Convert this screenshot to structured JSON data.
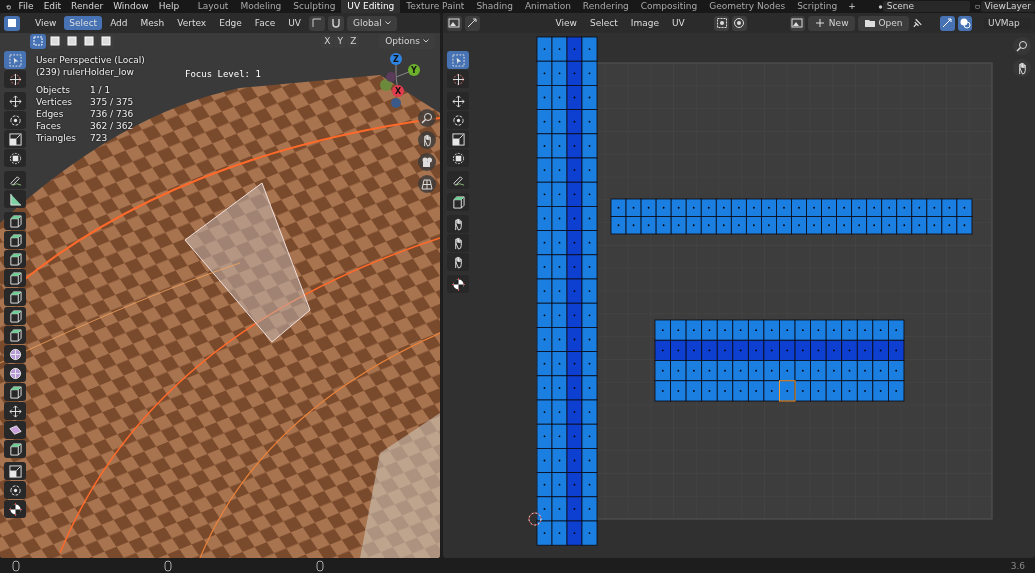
{
  "topbar": {
    "menus": [
      "File",
      "Edit",
      "Render",
      "Window",
      "Help"
    ],
    "workspaces": [
      {
        "label": "Layout",
        "selected": false
      },
      {
        "label": "Modeling",
        "selected": false
      },
      {
        "label": "Sculpting",
        "selected": false
      },
      {
        "label": "UV Editing",
        "selected": true
      },
      {
        "label": "Texture Paint",
        "selected": false
      },
      {
        "label": "Shading",
        "selected": false
      },
      {
        "label": "Animation",
        "selected": false
      },
      {
        "label": "Rendering",
        "selected": false
      },
      {
        "label": "Compositing",
        "selected": false
      },
      {
        "label": "Geometry Nodes",
        "selected": false
      },
      {
        "label": "Scripting",
        "selected": false
      }
    ],
    "add_tab": "+",
    "scene": "Scene",
    "view_layer": "ViewLayer"
  },
  "viewport": {
    "menus": [
      {
        "label": "View",
        "selected": false
      },
      {
        "label": "Select",
        "selected": true
      },
      {
        "label": "Add",
        "selected": false
      },
      {
        "label": "Mesh",
        "selected": false
      },
      {
        "label": "Vertex",
        "selected": false
      },
      {
        "label": "Edge",
        "selected": false
      },
      {
        "label": "Face",
        "selected": false
      },
      {
        "label": "UV",
        "selected": false
      }
    ],
    "orientation": "Global",
    "selection_modes": [
      {
        "selected": true
      },
      {
        "selected": false
      },
      {
        "selected": false
      },
      {
        "selected": false
      },
      {
        "selected": false
      }
    ],
    "axes": [
      "X",
      "Y",
      "Z"
    ],
    "options": "Options",
    "title": "User Perspective (Local)",
    "object": "(239) rulerHolder_low",
    "stats": [
      {
        "label": "Objects",
        "value": "1 / 1"
      },
      {
        "label": "Vertices",
        "value": "375 / 375"
      },
      {
        "label": "Edges",
        "value": "736 / 736"
      },
      {
        "label": "Faces",
        "value": "362 / 362"
      },
      {
        "label": "Triangles",
        "value": "723"
      }
    ],
    "focus": "Focus Level: 1",
    "gizmo": [
      "Z",
      "Y",
      "X"
    ],
    "toolbar": {
      "groups": [
        {
          "tools": [
            {
              "kind": "select",
              "selected": true
            },
            {
              "kind": "cursor",
              "selected": false
            }
          ]
        },
        {
          "tools": [
            {
              "kind": "move",
              "selected": false
            },
            {
              "kind": "rotate",
              "selected": false
            },
            {
              "kind": "scale",
              "selected": false
            },
            {
              "kind": "transform",
              "selected": false
            }
          ]
        },
        {
          "tools": [
            {
              "kind": "annotate",
              "selected": false
            },
            {
              "kind": "measure",
              "selected": false
            }
          ]
        },
        {
          "tools": [
            {
              "kind": "cube",
              "selected": false
            },
            {
              "kind": "cube",
              "selected": false
            },
            {
              "kind": "cube",
              "selected": false
            },
            {
              "kind": "cube",
              "selected": false
            },
            {
              "kind": "cube",
              "selected": false
            },
            {
              "kind": "cube",
              "selected": false
            },
            {
              "kind": "cube",
              "selected": false
            },
            {
              "kind": "sphere",
              "selected": false
            },
            {
              "kind": "sphere",
              "selected": false
            },
            {
              "kind": "cube",
              "selected": false
            },
            {
              "kind": "move",
              "selected": false
            },
            {
              "kind": "shear",
              "selected": false
            },
            {
              "kind": "cube",
              "selected": false
            }
          ]
        },
        {
          "tools": [
            {
              "kind": "scale",
              "selected": false
            },
            {
              "kind": "rotate",
              "selected": false
            },
            {
              "kind": "checker",
              "selected": false
            }
          ]
        }
      ]
    }
  },
  "uv_editor": {
    "menus": [
      "View",
      "Select",
      "Image",
      "UV"
    ],
    "new": "New",
    "open": "Open",
    "uv_map": "UVMap",
    "toolbar": {
      "groups": [
        {
          "tools": [
            {
              "kind": "select",
              "selected": true
            },
            {
              "kind": "cursor",
              "selected": false
            }
          ]
        },
        {
          "tools": [
            {
              "kind": "move",
              "selected": false
            },
            {
              "kind": "rotate",
              "selected": false
            },
            {
              "kind": "scale",
              "selected": false
            },
            {
              "kind": "transform",
              "selected": false
            }
          ]
        },
        {
          "tools": [
            {
              "kind": "annotate",
              "selected": false
            }
          ]
        },
        {
          "tools": [
            {
              "kind": "cube",
              "selected": false
            }
          ]
        },
        {
          "tools": [
            {
              "kind": "hand",
              "selected": false
            },
            {
              "kind": "hand",
              "selected": false
            },
            {
              "kind": "hand",
              "selected": false
            }
          ]
        },
        {
          "tools": [
            {
              "kind": "checker",
              "selected": false
            }
          ]
        }
      ]
    }
  },
  "status_bar": {
    "version": "3.6"
  }
}
